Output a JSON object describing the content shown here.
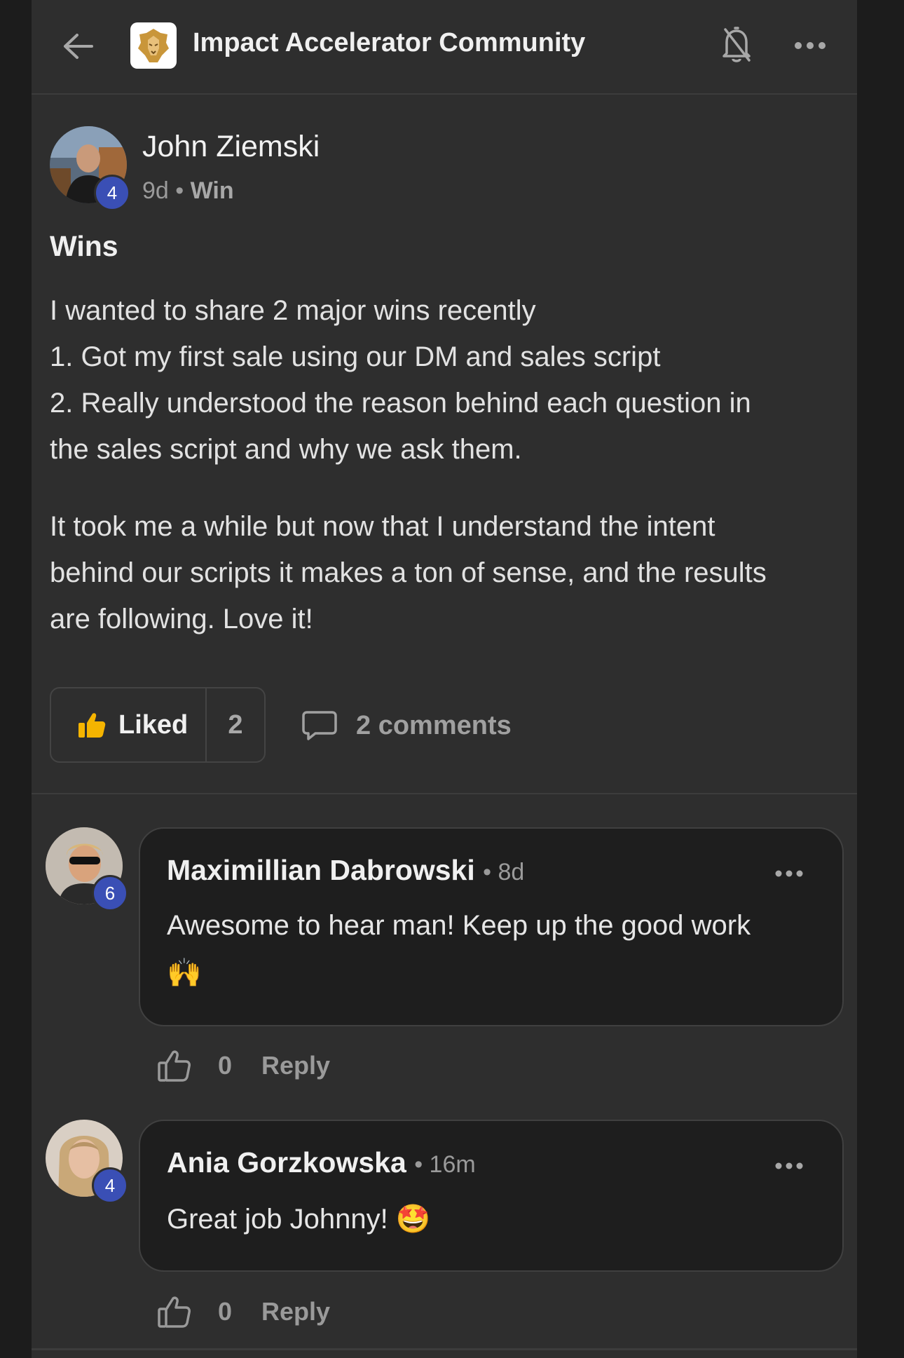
{
  "header": {
    "community_name": "Impact Accelerator Community",
    "icons": [
      "back-arrow-icon",
      "community-logo-lion",
      "bell-off-icon",
      "more-horizontal-icon"
    ]
  },
  "post": {
    "author": "John Ziemski",
    "author_level": "4",
    "age": "9d",
    "separator": "•",
    "category": "Win",
    "title": "Wins",
    "body_lines": [
      "I wanted to share 2 major wins recently",
      "1. Got my first sale using our DM and sales script",
      "2. Really understood the reason behind each question in",
      "the sales script and why we ask them."
    ],
    "body_lines_2": [
      "It took me a while but now that I understand the intent",
      "behind our scripts it makes a ton of sense, and the results",
      "are following. Love it!"
    ],
    "liked_label": "Liked",
    "like_count": "2",
    "comments_label": "2 comments"
  },
  "comments": [
    {
      "author": "Maximillian Dabrowski",
      "level": "6",
      "time": "• 8d",
      "text_line1": "Awesome to hear man! Keep up the good work",
      "text_line2": "🙌",
      "like_count": "0",
      "reply_label": "Reply"
    },
    {
      "author": "Ania Gorzkowska",
      "level": "4",
      "time": "• 16m",
      "text_line1": "Great job Johnny! 🤩",
      "like_count": "0",
      "reply_label": "Reply"
    }
  ],
  "colors": {
    "background": "#2e2e2e",
    "bubble": "#1e1e1e",
    "level_badge": "#3a4fb5",
    "like_icon": "#f5b400"
  }
}
